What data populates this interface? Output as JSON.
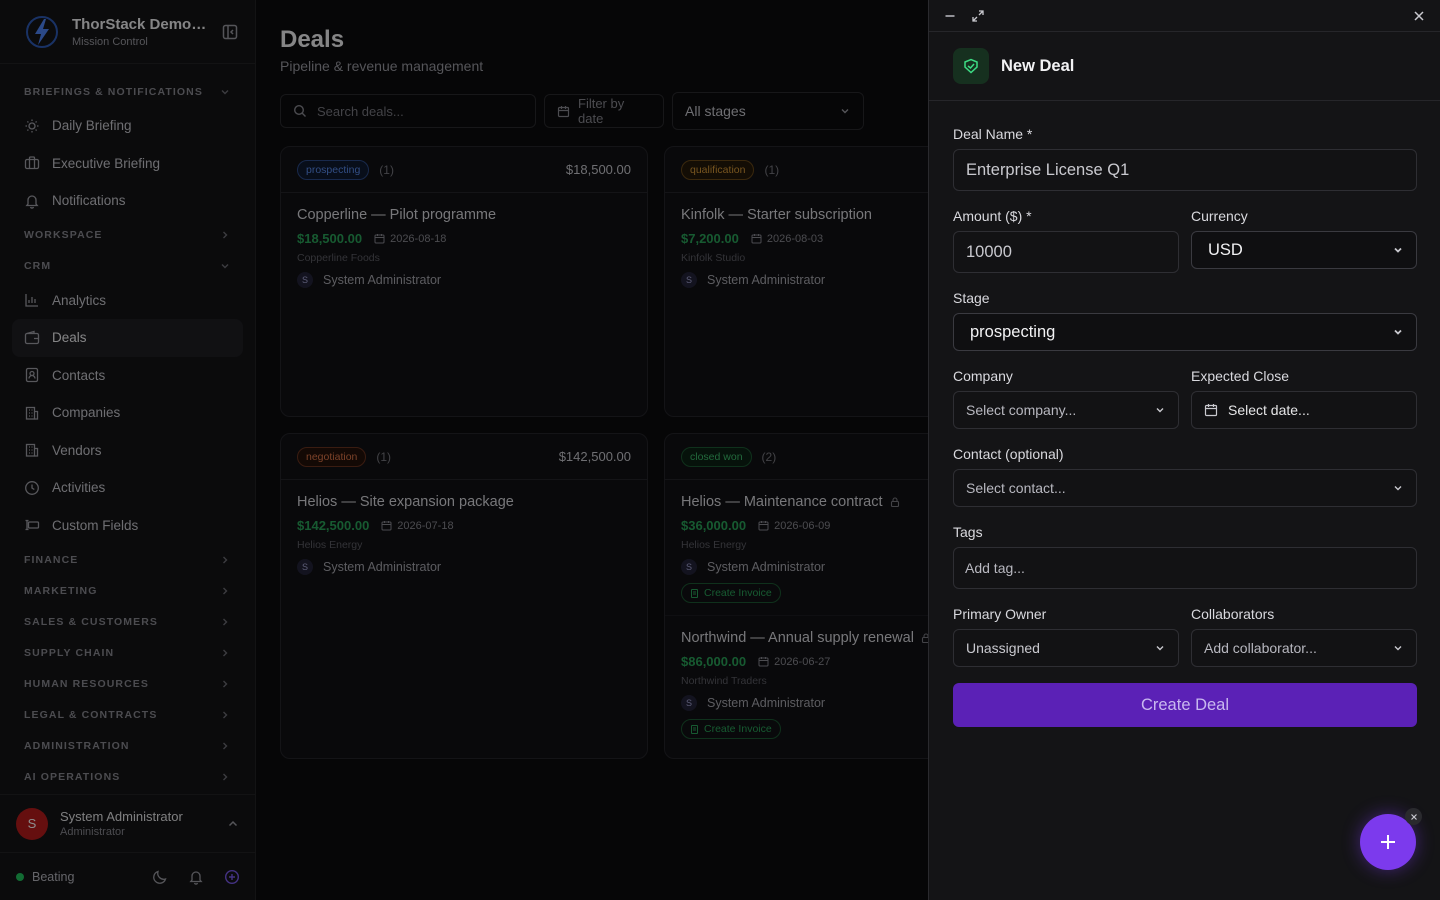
{
  "app": {
    "name": "ThorStack Demo C...",
    "subtitle": "Mission Control"
  },
  "sidebar": {
    "sections": [
      {
        "label": "BRIEFINGS & NOTIFICATIONS",
        "expanded": true
      },
      {
        "label": "WORKSPACE",
        "expanded": false
      },
      {
        "label": "CRM",
        "expanded": true
      },
      {
        "label": "FINANCE",
        "expanded": false
      },
      {
        "label": "MARKETING",
        "expanded": false
      },
      {
        "label": "SALES & CUSTOMERS",
        "expanded": false
      },
      {
        "label": "SUPPLY CHAIN",
        "expanded": false
      },
      {
        "label": "HUMAN RESOURCES",
        "expanded": false
      },
      {
        "label": "LEGAL & CONTRACTS",
        "expanded": false
      },
      {
        "label": "ADMINISTRATION",
        "expanded": false
      },
      {
        "label": "AI OPERATIONS",
        "expanded": false
      }
    ],
    "briefing_items": [
      {
        "label": "Daily Briefing",
        "icon": "sun-icon"
      },
      {
        "label": "Executive Briefing",
        "icon": "briefcase-icon"
      },
      {
        "label": "Notifications",
        "icon": "bell-icon"
      }
    ],
    "crm_items": [
      {
        "label": "Analytics",
        "icon": "bar-chart-icon"
      },
      {
        "label": "Deals",
        "icon": "wallet-icon",
        "active": true
      },
      {
        "label": "Contacts",
        "icon": "contact-icon"
      },
      {
        "label": "Companies",
        "icon": "building-icon"
      },
      {
        "label": "Vendors",
        "icon": "building-icon"
      },
      {
        "label": "Activities",
        "icon": "clock-icon"
      },
      {
        "label": "Custom Fields",
        "icon": "fields-icon"
      }
    ],
    "user": {
      "initial": "S",
      "name": "System Administrator",
      "role": "Administrator"
    },
    "status": "Beating"
  },
  "page": {
    "title": "Deals",
    "subtitle": "Pipeline & revenue management"
  },
  "toolbar": {
    "search_placeholder": "Search deals...",
    "filter_date": "Filter by date",
    "stage_filter": "All stages"
  },
  "columns": [
    {
      "stage": "prospecting",
      "count": "(1)",
      "total": "$18,500.00",
      "color": "#5b8def",
      "deals": [
        {
          "title": "Copperline — Pilot programme",
          "amount": "$18,500.00",
          "date": "2026-08-18",
          "company": "Copperline Foods",
          "owner": "System Administrator"
        }
      ]
    },
    {
      "stage": "qualification",
      "count": "(1)",
      "color": "#d89a3a",
      "deals": [
        {
          "title": "Kinfolk — Starter subscription",
          "amount": "$7,200.00",
          "date": "2026-08-03",
          "company": "Kinfolk Studio",
          "owner": "System Administrator"
        }
      ]
    },
    {
      "stage": "negotiation",
      "count": "(1)",
      "total": "$142,500.00",
      "color": "#e0774a",
      "deals": [
        {
          "title": "Helios — Site expansion package",
          "amount": "$142,500.00",
          "date": "2026-07-18",
          "company": "Helios Energy",
          "owner": "System Administrator"
        }
      ]
    },
    {
      "stage": "closed won",
      "count": "(2)",
      "color": "#3fbf6d",
      "deals": [
        {
          "title": "Helios — Maintenance contract",
          "amount": "$36,000.00",
          "date": "2026-06-09",
          "company": "Helios Energy",
          "owner": "System Administrator",
          "action": "Create Invoice"
        },
        {
          "title": "Northwind — Annual supply renewal",
          "amount": "$86,000.00",
          "date": "2026-06-27",
          "company": "Northwind Traders",
          "owner": "System Administrator",
          "action": "Create Invoice"
        }
      ]
    }
  ],
  "owner_initial": "S",
  "panel": {
    "title": "New Deal",
    "deal_name": {
      "label": "Deal Name *",
      "value": "Enterprise License Q1"
    },
    "amount": {
      "label": "Amount ($) *",
      "value": "10000"
    },
    "currency": {
      "label": "Currency",
      "value": "USD"
    },
    "stage": {
      "label": "Stage",
      "value": "prospecting"
    },
    "company": {
      "label": "Company",
      "placeholder": "Select company..."
    },
    "expected_close": {
      "label": "Expected Close",
      "placeholder": "Select date..."
    },
    "contact": {
      "label": "Contact (optional)",
      "placeholder": "Select contact..."
    },
    "tags": {
      "label": "Tags",
      "placeholder": "Add tag..."
    },
    "primary_owner": {
      "label": "Primary Owner",
      "value": "Unassigned"
    },
    "collaborators": {
      "label": "Collaborators",
      "placeholder": "Add collaborator..."
    },
    "submit": "Create Deal"
  }
}
